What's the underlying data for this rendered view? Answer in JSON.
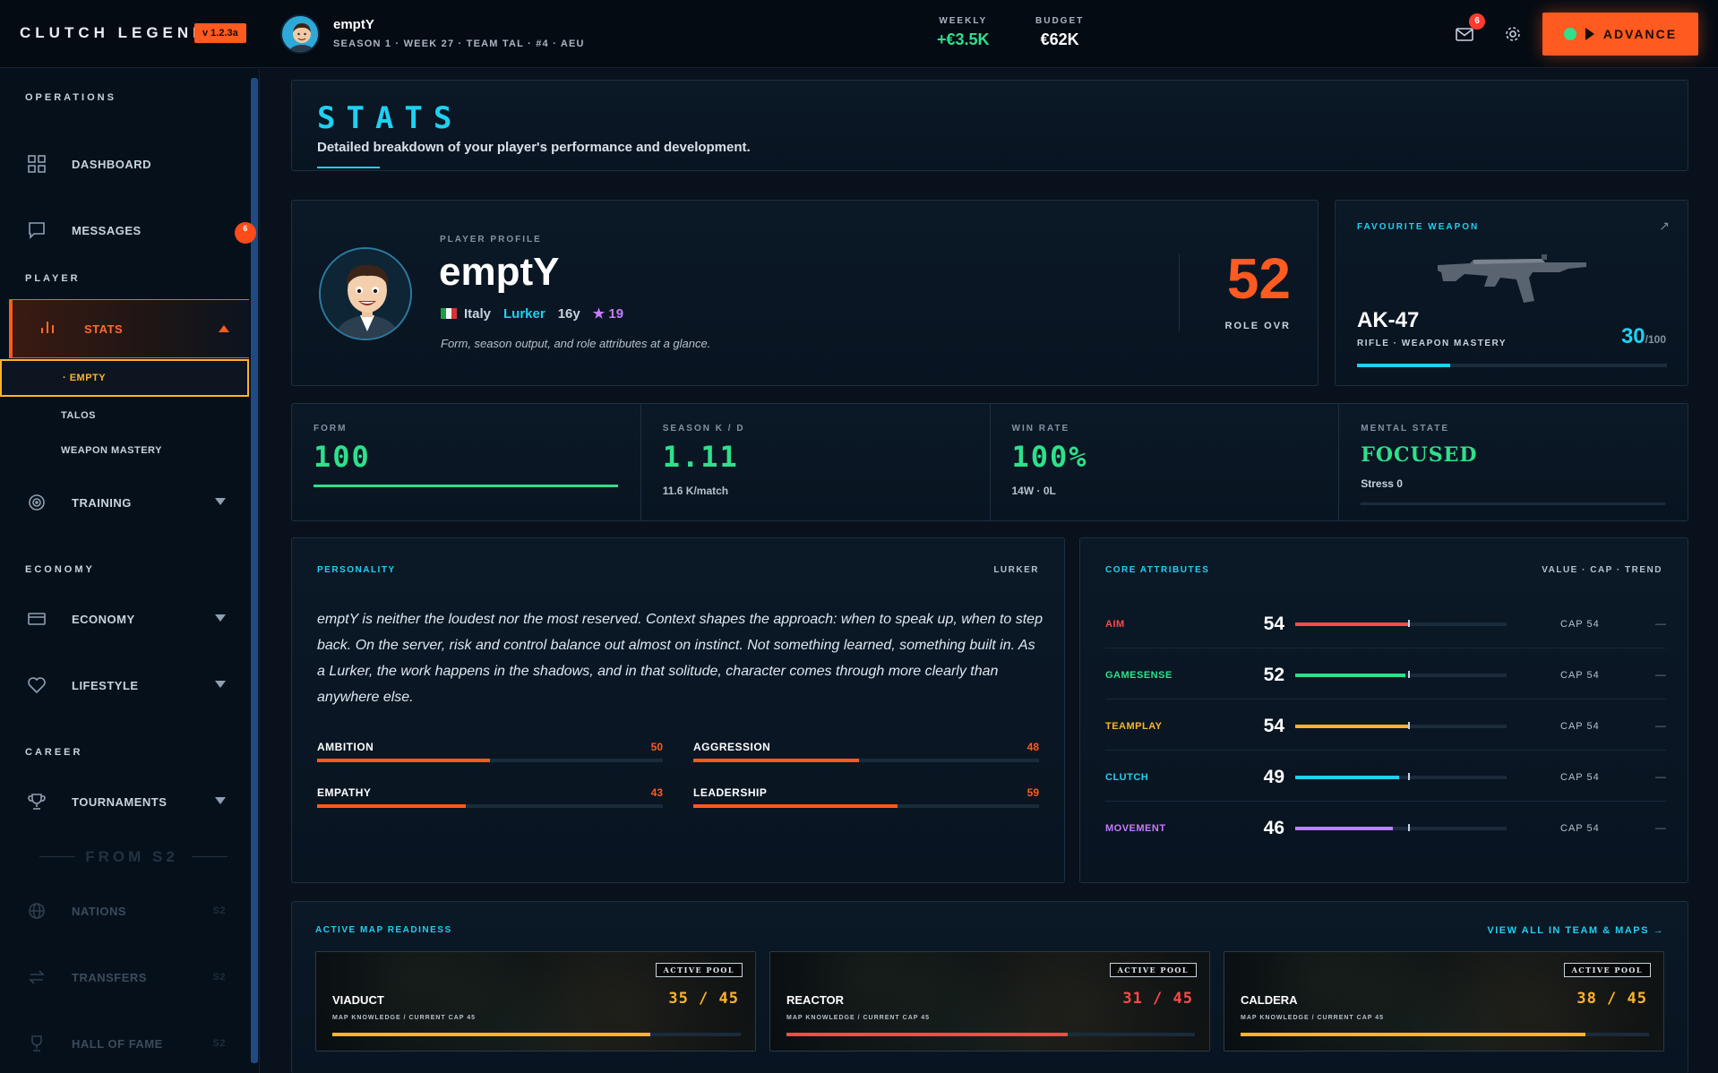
{
  "app": {
    "logo": "CLUTCH LEGEND",
    "version": "v 1.2.3a",
    "player_name": "emptY",
    "player_sub": "SEASON 1 · WEEK 27 · TEAM TAL · #4 · AEU",
    "weekly_label": "WEEKLY",
    "weekly_value": "+€3.5K",
    "budget_label": "BUDGET",
    "budget_value": "€62K",
    "mail_count": "6",
    "advance_label": "ADVANCE"
  },
  "sidebar": {
    "sections": {
      "operations": "OPERATIONS",
      "player": "PLAYER",
      "economy": "ECONOMY",
      "career": "CAREER"
    },
    "dashboard": "DASHBOARD",
    "messages": "MESSAGES",
    "messages_badge": "6",
    "stats": "STATS",
    "sub_empty": "· EMPTY",
    "sub_talos": "TALOS",
    "sub_weapon": "WEAPON MASTERY",
    "training": "TRAINING",
    "economy": "ECONOMY",
    "lifestyle": "LIFESTYLE",
    "tournaments": "TOURNAMENTS",
    "from_label": "FROM S2",
    "nations": "NATIONS",
    "transfers": "TRANSFERS",
    "hall_of_fame": "HALL OF FAME",
    "s2_tag": "S2"
  },
  "header": {
    "title": "STATS",
    "subtitle": "Detailed breakdown of your player's performance and development."
  },
  "profile": {
    "label": "PLAYER PROFILE",
    "name": "emptY",
    "country": "Italy",
    "role": "Lurker",
    "age": "16y",
    "stars": "★ 19",
    "desc": "Form, season output, and role attributes at a glance.",
    "ovr": "52",
    "ovr_label": "ROLE OVR"
  },
  "weapon": {
    "label": "FAVOURITE WEAPON",
    "name": "AK-47",
    "sub": "RIFLE · WEAPON MASTERY",
    "mastery": "30",
    "mastery_max": "/100",
    "mastery_fraction": 0.3
  },
  "kpis": {
    "form_label": "FORM",
    "form_value": "100",
    "kd_label": "SEASON K / D",
    "kd_value": "1.11",
    "kd_sub": "11.6 K/match",
    "win_label": "WIN RATE",
    "win_value": "100%",
    "win_sub": "14W · 0L",
    "mental_label": "MENTAL STATE",
    "mental_value": "FOCUSED",
    "mental_sub": "Stress 0"
  },
  "personality": {
    "title": "PERSONALITY",
    "role": "LURKER",
    "text": "emptY is neither the loudest nor the most reserved. Context shapes the approach: when to speak up, when to step back. On the server, risk and control balance out almost on instinct. Not something learned, something built in. As a Lurker, the work happens in the shadows, and in that solitude, character comes through more clearly than anywhere else.",
    "traits": [
      {
        "name": "AMBITION",
        "value": "50",
        "fraction": 0.5
      },
      {
        "name": "AGGRESSION",
        "value": "48",
        "fraction": 0.48
      },
      {
        "name": "EMPATHY",
        "value": "43",
        "fraction": 0.43
      },
      {
        "name": "LEADERSHIP",
        "value": "59",
        "fraction": 0.59
      }
    ]
  },
  "attributes": {
    "title": "CORE ATTRIBUTES",
    "legend": "VALUE · CAP · TREND",
    "rows": [
      {
        "name": "AIM",
        "value": "54",
        "cap": "CAP  54",
        "trend": "—",
        "color": "#ff4a4a",
        "fraction": 0.54
      },
      {
        "name": "GAMESENSE",
        "value": "52",
        "cap": "CAP  54",
        "trend": "—",
        "color": "#2ee08a",
        "fraction": 0.52
      },
      {
        "name": "TEAMPLAY",
        "value": "54",
        "cap": "CAP  54",
        "trend": "—",
        "color": "#ffb429",
        "fraction": 0.54
      },
      {
        "name": "CLUTCH",
        "value": "49",
        "cap": "CAP  54",
        "trend": "—",
        "color": "#1fd0f0",
        "fraction": 0.49
      },
      {
        "name": "MOVEMENT",
        "value": "46",
        "cap": "CAP  54",
        "trend": "—",
        "color": "#c57cff",
        "fraction": 0.46
      }
    ],
    "cap_fraction": 0.54
  },
  "maps": {
    "title": "ACTIVE MAP READINESS",
    "link": "VIEW ALL IN TEAM & MAPS →",
    "cards": [
      {
        "pool": "ACTIVE POOL",
        "name": "VIADUCT",
        "sub": "MAP KNOWLEDGE / CURRENT CAP 45",
        "score": "35 / 45",
        "color": "#ffb429",
        "fraction": 0.778
      },
      {
        "pool": "ACTIVE POOL",
        "name": "REACTOR",
        "sub": "MAP KNOWLEDGE / CURRENT CAP 45",
        "score": "31 / 45",
        "color": "#ff4a4a",
        "fraction": 0.689
      },
      {
        "pool": "ACTIVE POOL",
        "name": "CALDERA",
        "sub": "MAP KNOWLEDGE / CURRENT CAP 45",
        "score": "38 / 45",
        "color": "#ffb429",
        "fraction": 0.844
      }
    ]
  }
}
